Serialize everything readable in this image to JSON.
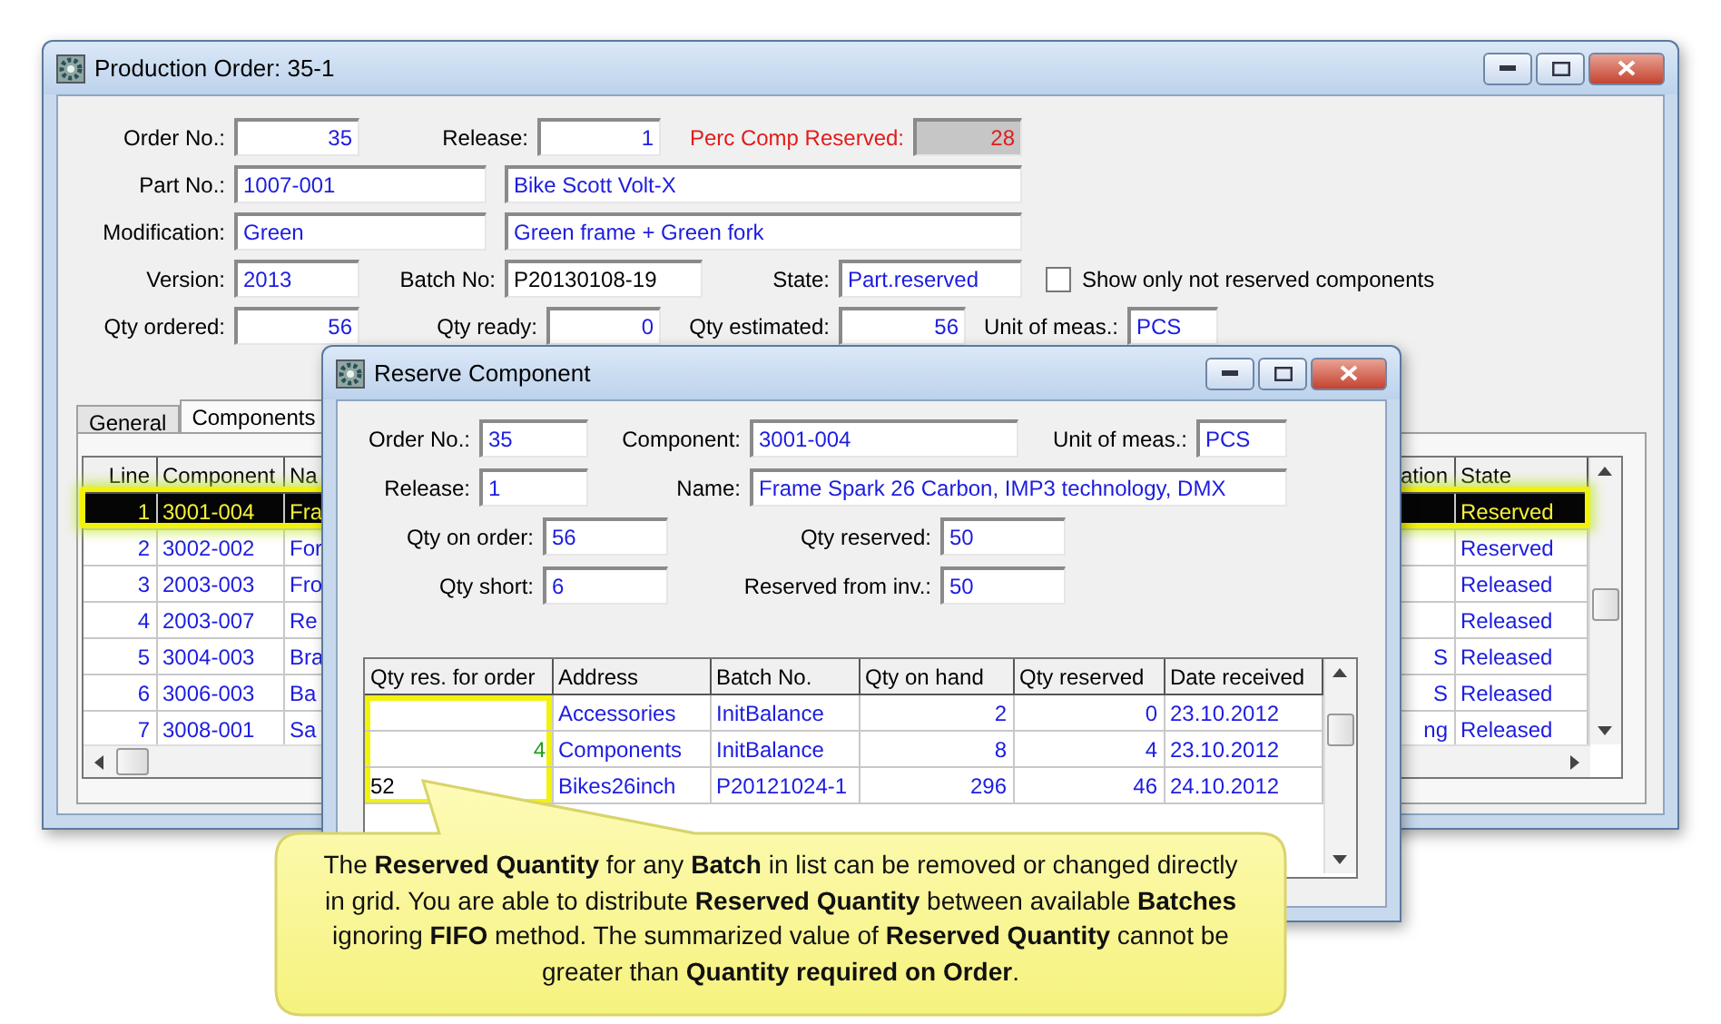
{
  "production_order_window": {
    "title": "Production Order: 35-1",
    "form_rows": [
      [
        {
          "kind": "number",
          "label": "Order No.:",
          "value": "35"
        },
        {
          "kind": "number",
          "label": "Release:",
          "value": "1"
        },
        {
          "kind": "warning",
          "label": "Perc Comp Reserved:",
          "value": "28"
        }
      ],
      [
        {
          "kind": "text",
          "label": "Part No.:",
          "value": "1007-001"
        },
        {
          "kind": "text",
          "value": "Bike Scott Volt-X"
        }
      ],
      [
        {
          "kind": "text",
          "label": "Modification:",
          "value": "Green"
        },
        {
          "kind": "text",
          "value": "Green frame + Green fork"
        }
      ],
      [
        {
          "kind": "text",
          "label": "Version:",
          "value": "2013"
        },
        {
          "kind": "plain",
          "label": "Batch No:",
          "value": "P20130108-19"
        },
        {
          "kind": "text",
          "label": "State:",
          "value": "Part.reserved"
        },
        {
          "kind": "checkbox",
          "label": "Show only not reserved components",
          "checked": false
        }
      ],
      [
        {
          "kind": "number",
          "label": "Qty ordered:",
          "value": "56"
        },
        {
          "kind": "number",
          "label": "Qty ready:",
          "value": "0"
        },
        {
          "kind": "number",
          "label": "Qty estimated:",
          "value": "56"
        },
        {
          "kind": "text",
          "label": "Unit of meas.:",
          "value": "PCS"
        }
      ]
    ],
    "tabs": [
      {
        "label": "General",
        "selected": false
      },
      {
        "label": "Components",
        "selected": true
      }
    ],
    "components_table": {
      "columns": [
        "Line",
        "Component",
        "Na",
        "ation",
        "State"
      ],
      "rows": [
        {
          "line": "1",
          "component": "3001-004",
          "name": "Fra",
          "state": "Reserved",
          "selected": true
        },
        {
          "line": "2",
          "component": "3002-002",
          "name": "For",
          "state": "Reserved",
          "selected": false
        },
        {
          "line": "3",
          "component": "2003-003",
          "name": "Fro",
          "state": "Released",
          "selected": false
        },
        {
          "line": "4",
          "component": "2003-007",
          "name": "Re",
          "state": "Released",
          "selected": false
        },
        {
          "line": "5",
          "component": "3004-003",
          "name": "Bra",
          "column_4": "S",
          "state": "Released",
          "selected": false
        },
        {
          "line": "6",
          "component": "3006-003",
          "name": "Ba",
          "column_4": "S",
          "state": "Released",
          "selected": false
        },
        {
          "line": "7",
          "component": "3008-001",
          "name": "Sa",
          "column_4": "ng",
          "state": "Released",
          "selected": false
        }
      ]
    }
  },
  "reserve_component_dialog": {
    "title": "Reserve Component",
    "form_rows": [
      [
        {
          "kind": "text",
          "label": "Order No.:",
          "value": "35"
        },
        {
          "kind": "text",
          "label": "Component:",
          "value": "3001-004"
        },
        {
          "kind": "text",
          "label": "Unit of meas.:",
          "value": "PCS"
        }
      ],
      [
        {
          "kind": "text",
          "label": "Release:",
          "value": "1"
        },
        {
          "kind": "text",
          "label": "Name:",
          "value": "Frame Spark 26 Carbon, IMP3 technology, DMX"
        }
      ],
      [
        {
          "kind": "text",
          "label": "Qty on order:",
          "value": "56"
        },
        {
          "kind": "text",
          "label": "Qty reserved:",
          "value": "50"
        }
      ],
      [
        {
          "kind": "text",
          "label": "Qty short:",
          "value": "6"
        },
        {
          "kind": "text",
          "label": "Reserved from inv.:",
          "value": "50"
        }
      ]
    ],
    "batches_table": {
      "columns": [
        "Qty res. for order",
        "Address",
        "Batch No.",
        "Qty on hand",
        "Qty reserved",
        "Date received"
      ],
      "rows": [
        {
          "address": "Accessories",
          "batch_no": "InitBalance",
          "qty_on_hand": "2",
          "qty_reserved": "0",
          "date_received": "23.10.2012",
          "editing": false
        },
        {
          "qty_res_for_order": "4",
          "address": "Components",
          "batch_no": "InitBalance",
          "qty_on_hand": "8",
          "qty_reserved": "4",
          "date_received": "23.10.2012",
          "editing": false
        },
        {
          "qty_res_for_order": "52",
          "address": "Bikes26inch",
          "batch_no": "P20121024-1",
          "qty_on_hand": "296",
          "qty_reserved": "46",
          "date_received": "24.10.2012",
          "editing": true
        }
      ]
    }
  },
  "callout": {
    "text": "The **Reserved Quantity** for any **Batch** in list can be removed or changed directly in grid. You are able to distribute **Reserved Quantity** between available **Batches** ignoring **FIFO** method. The summarized value of **Reserved Quantity** cannot be greater than **Quantity required on Order**."
  }
}
